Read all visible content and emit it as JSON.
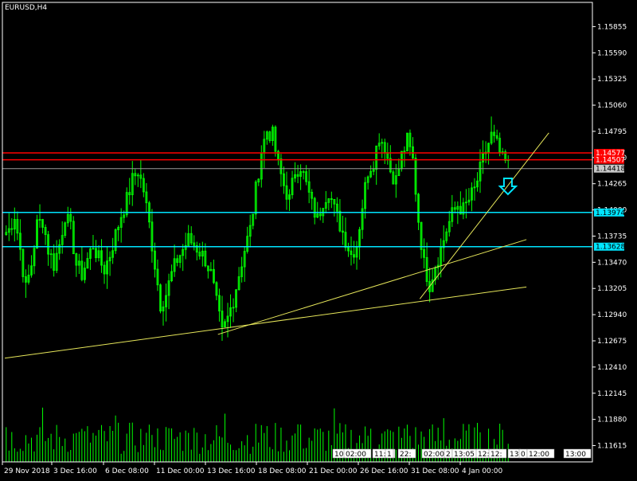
{
  "header": {
    "symbol_label": "EURUSD,H4"
  },
  "colors": {
    "background": "#000000",
    "candle": "#00ff00",
    "frame": "#ffffff",
    "resistance": "#ff0000",
    "support": "#00e5ff",
    "trendline": "#e6e65a",
    "volume": "#00ff00",
    "arrow": "#00e5ff",
    "current_price": "#9a9a9a"
  },
  "chart_data": {
    "type": "candlestick",
    "symbol": "EURUSD",
    "timeframe": "H4",
    "y_ticks": [
      "1.15855",
      "1.15590",
      "1.15325",
      "1.15060",
      "1.14795",
      "1.14530",
      "1.14265",
      "1.14000",
      "1.13735",
      "1.13470",
      "1.13205",
      "1.12940",
      "1.12675",
      "1.12410",
      "1.12145",
      "1.11880",
      "1.11615"
    ],
    "x_ticks": [
      "29 Nov 2018",
      "3 Dec 16:00",
      "6 Dec 08:00",
      "11 Dec 00:00",
      "13 Dec 16:00",
      "18 Dec 08:00",
      "21 Dec 00:00",
      "26 Dec 16:00",
      "31 Dec 08:00",
      "4 Jan 00:00"
    ],
    "ylim": [
      1.1145,
      1.161
    ],
    "grid": false,
    "price_path": [
      1.1375,
      1.138,
      1.1395,
      1.136,
      1.132,
      1.1345,
      1.1385,
      1.139,
      1.136,
      1.1345,
      1.1365,
      1.1395,
      1.138,
      1.1345,
      1.1335,
      1.135,
      1.1365,
      1.135,
      1.134,
      1.1355,
      1.1375,
      1.1395,
      1.141,
      1.143,
      1.144,
      1.142,
      1.1385,
      1.1345,
      1.1305,
      1.1315,
      1.1335,
      1.135,
      1.136,
      1.137,
      1.1365,
      1.1358,
      1.135,
      1.1335,
      1.1305,
      1.1275,
      1.129,
      1.131,
      1.1335,
      1.136,
      1.138,
      1.142,
      1.146,
      1.148,
      1.1475,
      1.1445,
      1.1425,
      1.141,
      1.144,
      1.1445,
      1.1425,
      1.1405,
      1.139,
      1.141,
      1.142,
      1.14,
      1.1385,
      1.137,
      1.1355,
      1.1365,
      1.1405,
      1.144,
      1.145,
      1.1475,
      1.1465,
      1.144,
      1.143,
      1.1455,
      1.147,
      1.145,
      1.139,
      1.1345,
      1.1325,
      1.1345,
      1.136,
      1.138,
      1.1395,
      1.1405,
      1.14,
      1.141,
      1.142,
      1.144,
      1.146,
      1.1475,
      1.1465,
      1.145,
      1.1445
    ],
    "horizontal_levels": [
      {
        "price": 1.14577,
        "label": "1.14577",
        "kind": "resistance"
      },
      {
        "price": 1.14507,
        "label": "1.14507",
        "kind": "resistance"
      },
      {
        "price": 1.13974,
        "label": "1.13974",
        "kind": "support"
      },
      {
        "price": 1.13628,
        "label": "1.13628",
        "kind": "support"
      }
    ],
    "current_price": {
      "price": 1.14418,
      "label": "1.14418"
    },
    "trendlines": [
      {
        "from": {
          "bar": 0,
          "price": 1.125
        },
        "to": {
          "bar": 93,
          "price": 1.1322
        }
      },
      {
        "from": {
          "bar": 38,
          "price": 1.1274
        },
        "to": {
          "bar": 93,
          "price": 1.137
        }
      },
      {
        "from": {
          "bar": 74,
          "price": 1.131
        },
        "to": {
          "bar": 97,
          "price": 1.1478
        }
      }
    ],
    "signal_arrow": {
      "direction": "down",
      "bar": 88
    },
    "volume_ticks": [
      "10:",
      "02:00",
      "11:0",
      "1",
      "22:",
      "02:00",
      "2",
      "13:05",
      "12:0",
      "12:",
      "13",
      "0",
      "12:00",
      "13:00"
    ]
  }
}
